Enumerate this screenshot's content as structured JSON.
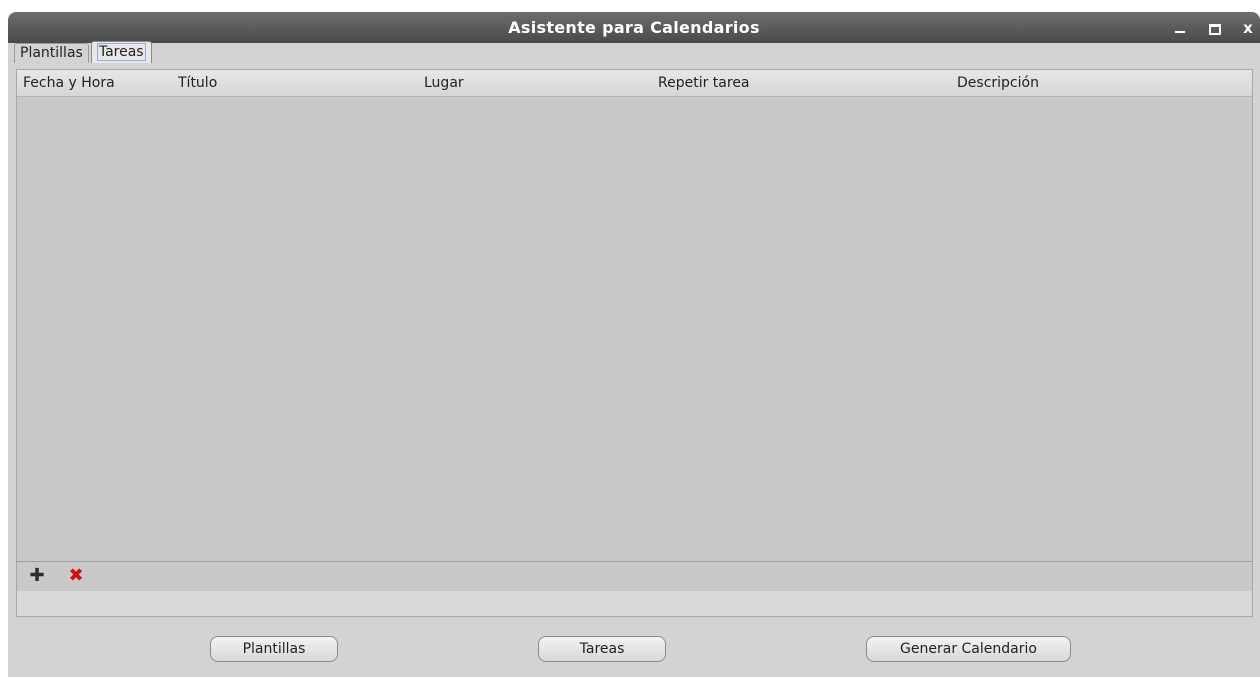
{
  "window": {
    "title": "Asistente para Calendarios",
    "controls": {
      "minimize": "_",
      "maximize": "□",
      "close": "x"
    }
  },
  "tabs": [
    {
      "label": "Plantillas",
      "active": false
    },
    {
      "label": "Tareas",
      "active": true
    }
  ],
  "table": {
    "columns": [
      "Fecha y Hora",
      "Título",
      "Lugar",
      "Repetir tarea",
      "Descripción"
    ],
    "rows": []
  },
  "toolbar": {
    "add_icon": "plus-icon",
    "remove_icon": "delete-icon",
    "add_glyph": "✚",
    "remove_glyph": "✖",
    "add_color": "#2b2b2b",
    "remove_color": "#cc1111"
  },
  "buttons": {
    "plantillas": "Plantillas",
    "tareas": "Tareas",
    "generar": "Generar Calendario"
  }
}
